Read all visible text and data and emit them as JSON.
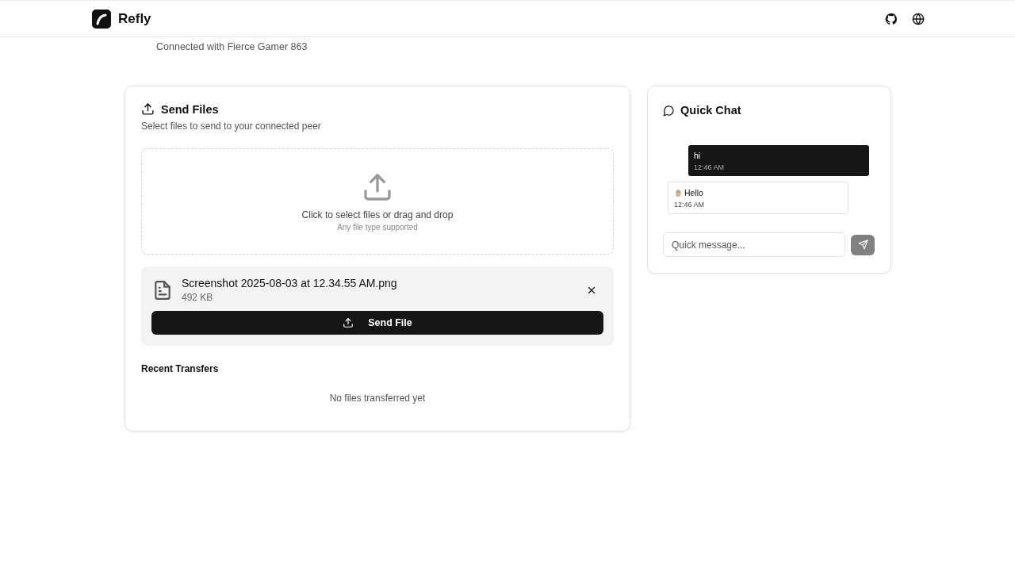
{
  "header": {
    "brand": "Refly"
  },
  "connection": {
    "subtitle": "Connected with Fierce Gamer 863"
  },
  "send_files": {
    "title": "Send Files",
    "description": "Select files to send to your connected peer",
    "dropzone": {
      "prompt": "Click to select files or drag and drop",
      "hint": "Any file type supported"
    },
    "selected_file": {
      "name": "Screenshot 2025-08-03 at 12.34.55 AM.png",
      "size": "492 KB"
    },
    "send_button": "Send File",
    "recent": {
      "title": "Recent Transfers",
      "empty": "No files transferred yet"
    }
  },
  "quick_chat": {
    "title": "Quick Chat",
    "messages": [
      {
        "kind": "sent",
        "text": "hi",
        "time": "12:46 AM"
      },
      {
        "kind": "received",
        "wave": true,
        "text": "Hello",
        "time": "12:46 AM"
      }
    ],
    "input": {
      "placeholder": "Quick message..."
    }
  }
}
